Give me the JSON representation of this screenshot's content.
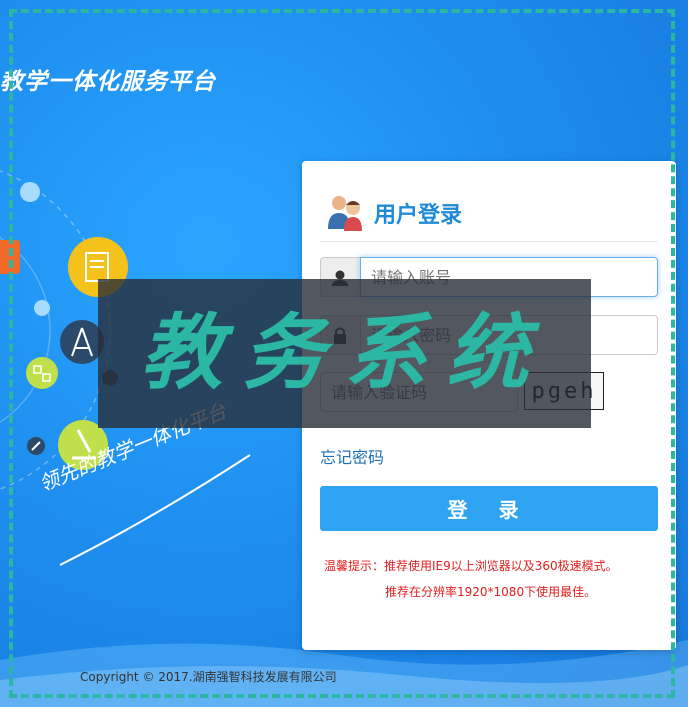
{
  "header": {
    "platform_title": "教学一体化服务平台"
  },
  "slogan": "领先的教学一体化平台",
  "login": {
    "title": "用户登录",
    "account_placeholder": "请输入账号",
    "password_placeholder": "请输入密码",
    "captcha_placeholder": "请输入验证码",
    "captcha_text": "pgeh",
    "forgot_password": "忘记密码",
    "submit_label": "登 录",
    "tip_line1": "温馨提示：推荐使用IE9以上浏览器以及360极速模式。",
    "tip_line2": "推荐在分辨率1920*1080下使用最佳。"
  },
  "footer": {
    "copyright": "Copyright © 2017.湖南强智科技发展有限公司"
  },
  "watermark": {
    "text": "教务系统"
  },
  "colors": {
    "background": "#1e8eef",
    "accent": "#2ea3f2",
    "title": "#1f8ad8",
    "tip": "#e02020",
    "watermark_text": "#2bb7a3",
    "dash_frame": "#2bb7a3"
  },
  "icons": [
    "users-icon",
    "user-icon",
    "lock-icon",
    "ruler-compass-icon",
    "document-icon",
    "microscope-icon",
    "molecule-icon",
    "rocket-icon"
  ]
}
